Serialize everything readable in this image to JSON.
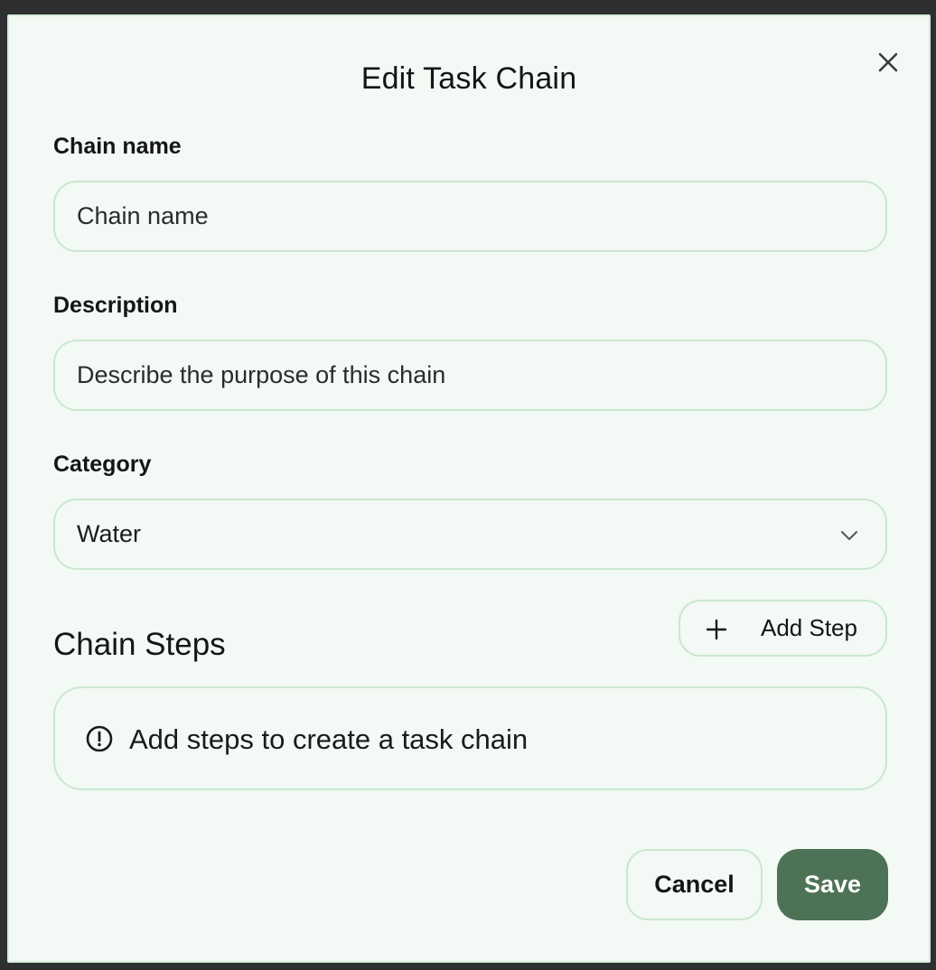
{
  "dialog": {
    "title": "Edit Task Chain",
    "close_icon": "close-icon"
  },
  "fields": {
    "name": {
      "label": "Chain name",
      "placeholder": "Chain name",
      "value": ""
    },
    "description": {
      "label": "Description",
      "placeholder": "Describe the purpose of this chain",
      "value": ""
    },
    "category": {
      "label": "Category",
      "selected": "Water",
      "icon": "chevron-down-icon"
    }
  },
  "steps": {
    "heading": "Chain Steps",
    "add_button_label": "Add Step",
    "add_icon": "plus-icon",
    "empty_message": "Add steps to create a task chain",
    "empty_icon": "alert-circle-icon"
  },
  "actions": {
    "cancel_label": "Cancel",
    "save_label": "Save"
  },
  "colors": {
    "dialog_background": "#f3f9f4",
    "border": "#c9e8cf",
    "primary": "#4e7255",
    "backdrop": "#2e2f31"
  }
}
